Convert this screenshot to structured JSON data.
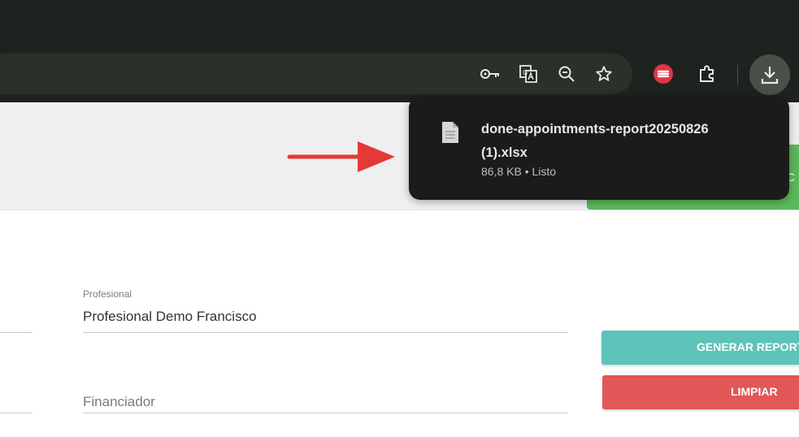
{
  "download": {
    "filename_line1": "done-appointments-report20250826",
    "filename_line2": "(1).xlsx",
    "meta": "86,8 KB • Listo"
  },
  "form": {
    "profesional_label": "Profesional",
    "profesional_value": "Profesional Demo Francisco",
    "financiador_placeholder": "Financiador"
  },
  "buttons": {
    "generate_label": "GENERAR REPORTE",
    "clear_label": "LIMPIAR",
    "partial_green_label": "C"
  },
  "icons": {
    "toolbar": [
      "key-icon",
      "translate-icon",
      "zoom-icon",
      "star-icon",
      "extension-red-icon",
      "puzzle-icon",
      "download-icon"
    ]
  },
  "colors": {
    "chrome_bg": "#1f231f",
    "bubble_bg": "#1b1b1b",
    "generate": "#5ec3b8",
    "clear": "#e25757",
    "green": "#5cb85c",
    "arrow": "#e53935"
  }
}
